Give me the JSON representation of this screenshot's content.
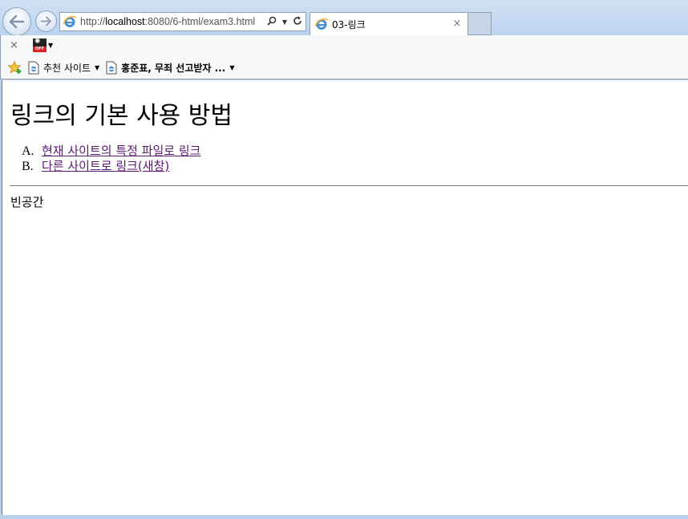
{
  "browser": {
    "address": {
      "url_prefix": "http://",
      "url_host": "localhost",
      "url_rest": ":8080/6-html/exam3.html"
    },
    "tab": {
      "title": "03-링크",
      "close_glyph": "×"
    },
    "command_bar": {
      "close_glyph": "×",
      "addon_badge": "OFF"
    },
    "favorites": {
      "items": [
        {
          "label": "추천 사이트",
          "icon": "page-icon"
        },
        {
          "label": "홍준표, 무죄 선고받자 ...",
          "icon": "ie-page-icon"
        }
      ]
    }
  },
  "page": {
    "heading": "링크의 기본 사용 방법",
    "links": [
      {
        "marker": "A.",
        "label": "현재 사이트의 특정 파일로 링크"
      },
      {
        "marker": "B.",
        "label": "다른 사이트로 링크(새창)"
      }
    ],
    "empty_text": "빈공간"
  },
  "colors": {
    "frame": "#b9d1ea",
    "visited_link": "#5a1a73"
  }
}
